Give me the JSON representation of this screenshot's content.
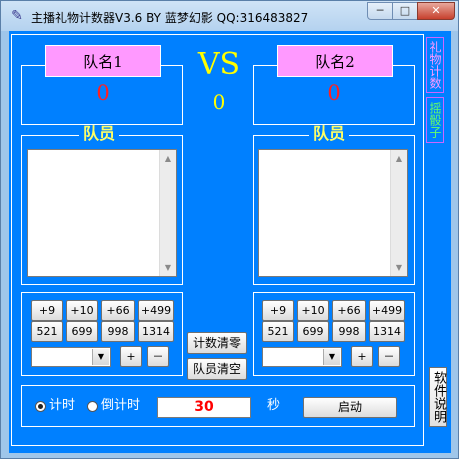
{
  "window": {
    "title": "主播礼物计数器V3.6  BY 蓝梦幻影 QQ:316483827",
    "minimize": "─",
    "maximize": "□",
    "close": "✕",
    "app_icon": "feather-icon"
  },
  "teams": {
    "left": {
      "name": "队名1",
      "score": "0"
    },
    "right": {
      "name": "队名2",
      "score": "0"
    }
  },
  "vs_label": "VS",
  "center_count": "0",
  "members_legend": "队员",
  "gift_buttons": [
    "+9",
    "+10",
    "+66",
    "+499",
    "521",
    "699",
    "998",
    "1314"
  ],
  "plus_label": "+",
  "minus_label": "－",
  "center_buttons": {
    "reset_count": "计数清零",
    "clear_members": "队员清空"
  },
  "side_buttons": {
    "gift_count": "礼物计数",
    "dice": "摇骰子"
  },
  "help_button": "软件说明",
  "timer": {
    "mode_count_up": "计时",
    "mode_count_down": "倒计时",
    "selected": "count_up",
    "value": "30",
    "unit": "秒",
    "start_button": "启动"
  },
  "colors": {
    "client_bg": "#0080ff",
    "accent_yellow": "#ffff00",
    "score_red": "#ff2020",
    "team_name_bg": "#ff99ff"
  }
}
